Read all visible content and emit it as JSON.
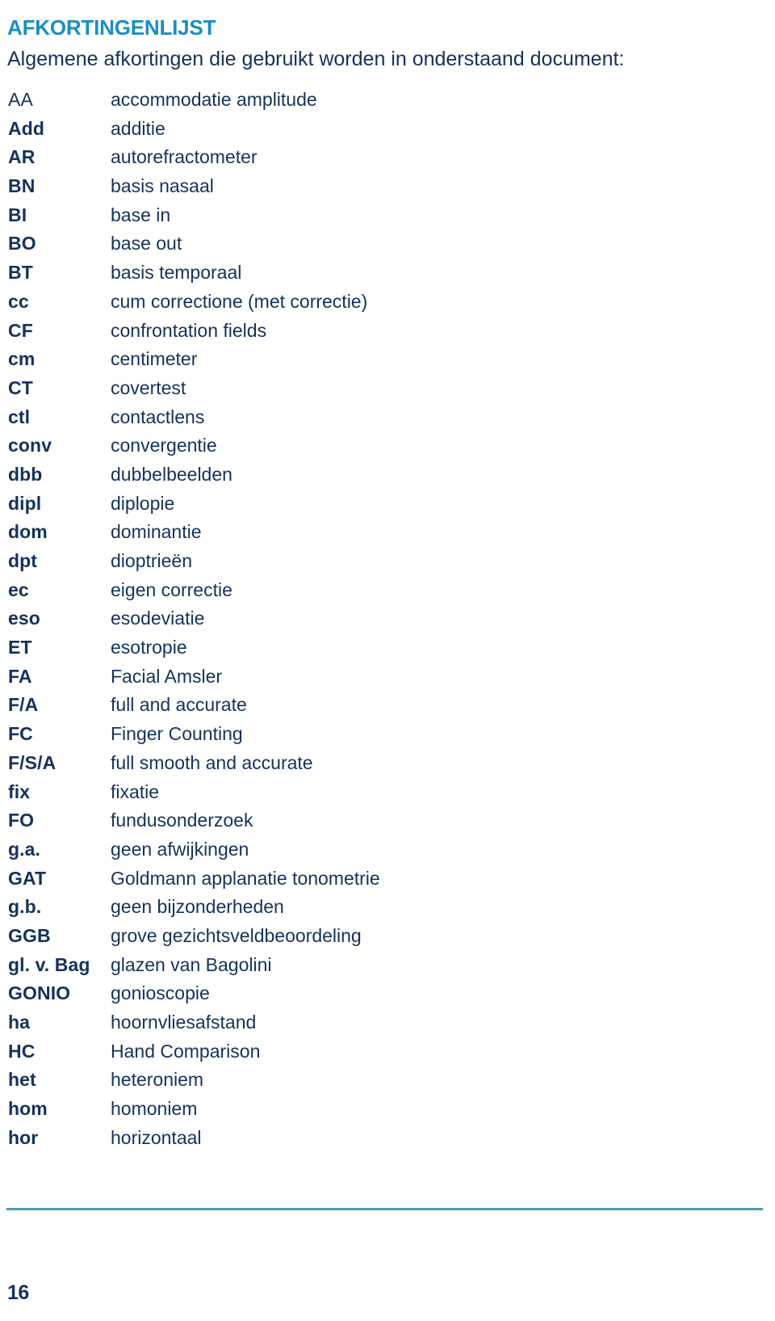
{
  "document": {
    "title": "AFKORTINGENLIJST",
    "subtitle": "Algemene afkortingen die gebruikt worden in onderstaand document:",
    "page_number": "16"
  },
  "colors": {
    "title": "#1a8ec4",
    "body": "#15325c",
    "rule": "#4d9cb5",
    "background": "#ffffff"
  },
  "abbreviations": [
    {
      "term": "AA",
      "definition": "accommodatie amplitude",
      "bold": false
    },
    {
      "term": "Add",
      "definition": "additie",
      "bold": true
    },
    {
      "term": "AR",
      "definition": "autorefractometer",
      "bold": true
    },
    {
      "term": "BN",
      "definition": "basis nasaal",
      "bold": true
    },
    {
      "term": "BI",
      "definition": "base in",
      "bold": true
    },
    {
      "term": "BO",
      "definition": "base out",
      "bold": true
    },
    {
      "term": "BT",
      "definition": "basis temporaal",
      "bold": true
    },
    {
      "term": "cc",
      "definition": "cum correctione (met correctie)",
      "bold": true
    },
    {
      "term": "CF",
      "definition": "confrontation fields",
      "bold": true
    },
    {
      "term": "cm",
      "definition": "centimeter",
      "bold": true
    },
    {
      "term": "CT",
      "definition": "covertest",
      "bold": true
    },
    {
      "term": "ctl",
      "definition": "contactlens",
      "bold": true
    },
    {
      "term": "conv",
      "definition": "convergentie",
      "bold": true
    },
    {
      "term": "dbb",
      "definition": "dubbelbeelden",
      "bold": true
    },
    {
      "term": "dipl",
      "definition": "diplopie",
      "bold": true
    },
    {
      "term": "dom",
      "definition": "dominantie",
      "bold": true
    },
    {
      "term": "dpt",
      "definition": "dioptrieën",
      "bold": true
    },
    {
      "term": "ec",
      "definition": "eigen correctie",
      "bold": true
    },
    {
      "term": "eso",
      "definition": "esodeviatie",
      "bold": true
    },
    {
      "term": "ET",
      "definition": "esotropie",
      "bold": true
    },
    {
      "term": "FA",
      "definition": "Facial Amsler",
      "bold": true
    },
    {
      "term": "F/A",
      "definition": "full and accurate",
      "bold": true
    },
    {
      "term": "FC",
      "definition": "Finger Counting",
      "bold": true
    },
    {
      "term": "F/S/A",
      "definition": "full smooth and accurate",
      "bold": true
    },
    {
      "term": "fix",
      "definition": "fixatie",
      "bold": true
    },
    {
      "term": "FO",
      "definition": "fundusonderzoek",
      "bold": true
    },
    {
      "term": "g.a.",
      "definition": "geen afwijkingen",
      "bold": true
    },
    {
      "term": "GAT",
      "definition": "Goldmann applanatie tonometrie",
      "bold": true
    },
    {
      "term": "g.b.",
      "definition": "geen bijzonderheden",
      "bold": true
    },
    {
      "term": "GGB",
      "definition": "grove gezichtsveldbeoordeling",
      "bold": true
    },
    {
      "term": "gl. v. Bag",
      "definition": "glazen van Bagolini",
      "bold": true
    },
    {
      "term": "GONIO",
      "definition": "gonioscopie",
      "bold": true
    },
    {
      "term": "ha",
      "definition": "hoornvliesafstand",
      "bold": true
    },
    {
      "term": "HC",
      "definition": "Hand Comparison",
      "bold": true
    },
    {
      "term": "het",
      "definition": "heteroniem",
      "bold": true
    },
    {
      "term": "hom",
      "definition": "homoniem",
      "bold": true
    },
    {
      "term": "hor",
      "definition": "horizontaal",
      "bold": true
    }
  ]
}
